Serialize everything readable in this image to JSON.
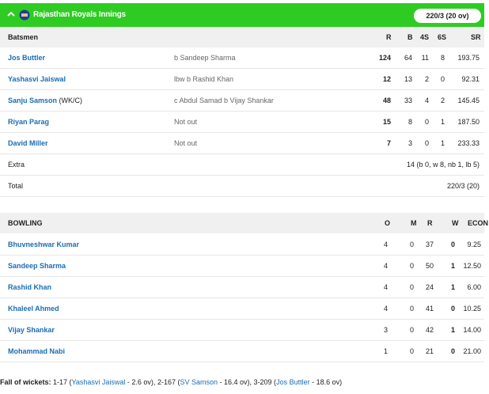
{
  "innings": {
    "title": "Rajasthan Royals Innings",
    "score": "220/3 (20 ov)"
  },
  "batting": {
    "headers": {
      "batsmen": "Batsmen",
      "r": "R",
      "b": "B",
      "fours": "4S",
      "sixes": "6S",
      "sr": "SR"
    },
    "rows": [
      {
        "name": "Jos Buttler",
        "suffix": "",
        "dismissal": "b Sandeep Sharma",
        "r": "124",
        "b": "64",
        "fours": "11",
        "sixes": "8",
        "sr": "193.75"
      },
      {
        "name": "Yashasvi Jaiswal",
        "suffix": "",
        "dismissal": "lbw b Rashid Khan",
        "r": "12",
        "b": "13",
        "fours": "2",
        "sixes": "0",
        "sr": "92.31"
      },
      {
        "name": "Sanju Samson",
        "suffix": "(WK/C)",
        "dismissal": "c Abdul Samad b Vijay Shankar",
        "r": "48",
        "b": "33",
        "fours": "4",
        "sixes": "2",
        "sr": "145.45"
      },
      {
        "name": "Riyan Parag",
        "suffix": "",
        "dismissal": "Not out",
        "r": "15",
        "b": "8",
        "fours": "0",
        "sixes": "1",
        "sr": "187.50"
      },
      {
        "name": "David Miller",
        "suffix": "",
        "dismissal": "Not out",
        "r": "7",
        "b": "3",
        "fours": "0",
        "sixes": "1",
        "sr": "233.33"
      }
    ],
    "extras": {
      "label": "Extra",
      "value": "14 (b 0, w 8, nb 1, lb 5)"
    },
    "total": {
      "label": "Total",
      "value": "220/3 (20)"
    }
  },
  "bowling": {
    "headers": {
      "bowling": "BOWLING",
      "o": "O",
      "m": "M",
      "r": "R",
      "w": "W",
      "econ": "ECON"
    },
    "rows": [
      {
        "name": "Bhuvneshwar Kumar",
        "o": "4",
        "m": "0",
        "r": "37",
        "w": "0",
        "econ": "9.25"
      },
      {
        "name": "Sandeep Sharma",
        "o": "4",
        "m": "0",
        "r": "50",
        "w": "1",
        "econ": "12.50"
      },
      {
        "name": "Rashid Khan",
        "o": "4",
        "m": "0",
        "r": "24",
        "w": "1",
        "econ": "6.00"
      },
      {
        "name": "Khaleel Ahmed",
        "o": "4",
        "m": "0",
        "r": "41",
        "w": "0",
        "econ": "10.25"
      },
      {
        "name": "Vijay Shankar",
        "o": "3",
        "m": "0",
        "r": "42",
        "w": "1",
        "econ": "14.00"
      },
      {
        "name": "Mohammad Nabi",
        "o": "1",
        "m": "0",
        "r": "21",
        "w": "0",
        "econ": "21.00"
      }
    ]
  },
  "fall_of_wickets": {
    "label": "Fall of wickets:",
    "items": [
      {
        "prefix": " 1-17 (",
        "player": "Yashasvi Jaiswal",
        "suffix": " - 2.6 ov),"
      },
      {
        "prefix": " 2-167 (",
        "player": "SV Samson",
        "suffix": " - 16.4 ov),"
      },
      {
        "prefix": " 3-209 (",
        "player": "Jos Buttler",
        "suffix": " - 18.6 ov)"
      }
    ]
  },
  "colors": {
    "accent": "#2ecc22",
    "link": "#1a6db5"
  },
  "icons": {
    "collapse": "chevron-up-icon",
    "team": "team-logo-icon"
  }
}
